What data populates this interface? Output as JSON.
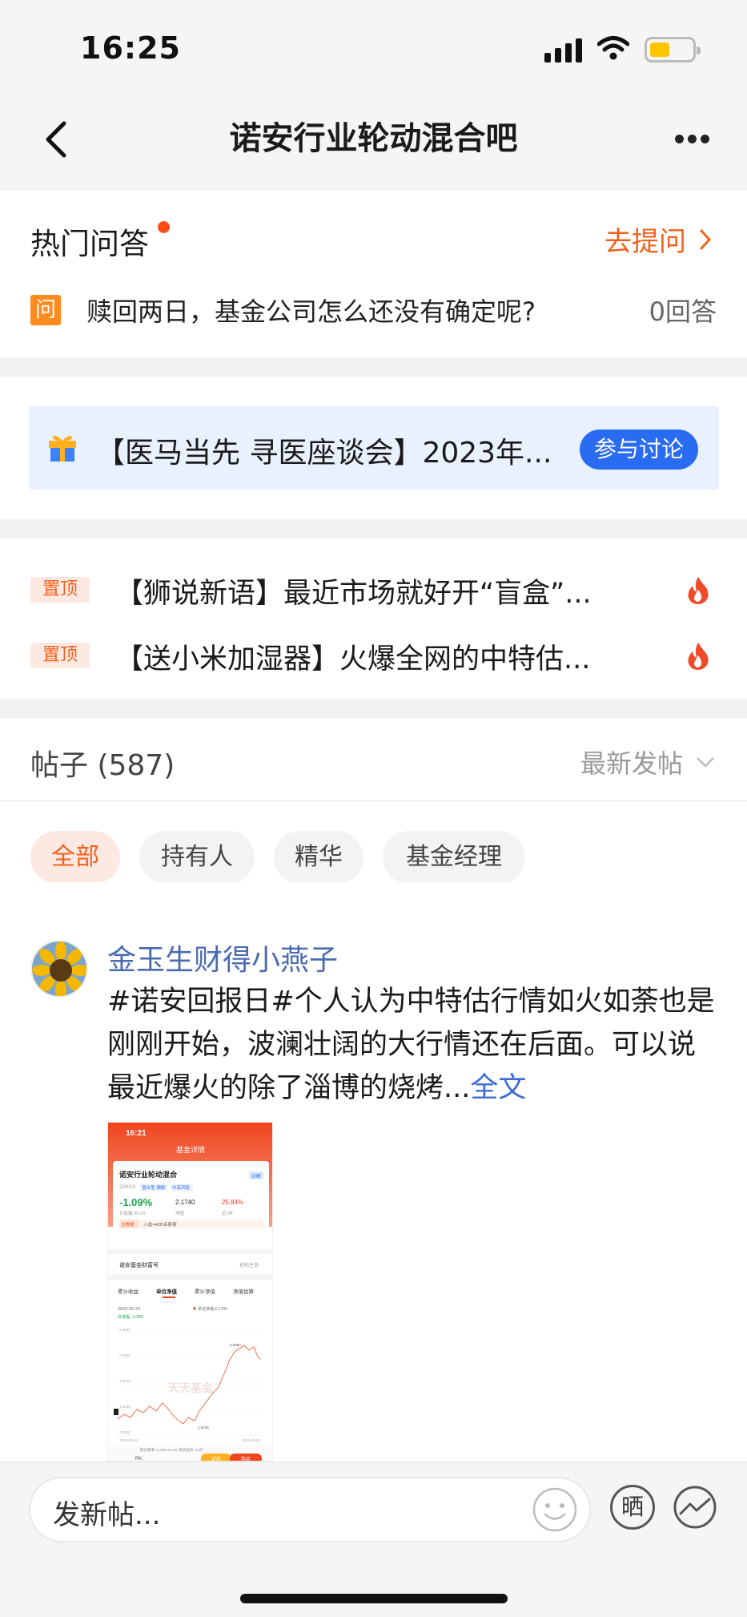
{
  "status_bar": {
    "time": "16:25"
  },
  "header": {
    "title": "诺安行业轮动混合吧"
  },
  "hot_qa": {
    "title": "热门问答",
    "ask_label": "去提问",
    "question_icon": "问",
    "question": "赎回两日，基金公司怎么还没有确定呢?",
    "answer_count": "0回答"
  },
  "banner": {
    "text": "【医马当先 寻医座谈会】2023年...",
    "button": "参与讨论"
  },
  "pinned": [
    {
      "tag": "置顶",
      "text": "【狮说新语】最近市场就好开“盲盒”..."
    },
    {
      "tag": "置顶",
      "text": "【送小米加湿器】火爆全网的中特估..."
    }
  ],
  "posts": {
    "title": "帖子 (587)",
    "sort": "最新发帖",
    "filters": [
      "全部",
      "持有人",
      "精华",
      "基金经理"
    ],
    "active_filter": 0
  },
  "post": {
    "author": "金玉生财得小燕子",
    "content": "#诺安回报日#个人认为中特估行情如火如荼也是刚刚开始，波澜壮阔的大行情还在后面。可以说最近爆火的除了淄博的烧烤...",
    "full_link": "全文",
    "thumbnail": {
      "time": "16:21",
      "page_title": "基金详情",
      "fund_name": "诺安行业轮动混合",
      "fund_code": "320015",
      "badge": "诊断",
      "tag1": "混合型-偏股",
      "tag2": "中高风险",
      "change": "-1.09%",
      "nav": "2.1740",
      "one_year": "25.84%",
      "change_label": "日涨幅 05-23",
      "nav_label": "净值",
      "one_year_label": "近1年",
      "notice": "入选-4435名新榜",
      "notice_tag": "大数据",
      "company": "诺安基金财富号",
      "company_link": "机构主页",
      "tabs": [
        "累计收益",
        "单位净值",
        "累计净值",
        "净值估算"
      ],
      "chart_date": "2023-05-23",
      "chart_legend": "单位净值:2.1740",
      "chart_change": "日涨幅:-1.09%",
      "y_ticks": [
        "2.6000",
        "2.2000",
        "1.8000",
        "1.4000",
        "1.0000"
      ],
      "peak_label": "2.5083",
      "low_label": "1.6158",
      "x_start": "2020-05-24",
      "x_end": "2023-05-23",
      "watermark": "天天基金",
      "fee_line": "购买费率: 1.00% 0.12%  购买起点: 10元",
      "bottom_pk": "PK",
      "buy_btn": "定投",
      "sell_btn": "购买"
    }
  },
  "composer": {
    "placeholder": "发新帖...",
    "sun_label": "晒"
  }
}
